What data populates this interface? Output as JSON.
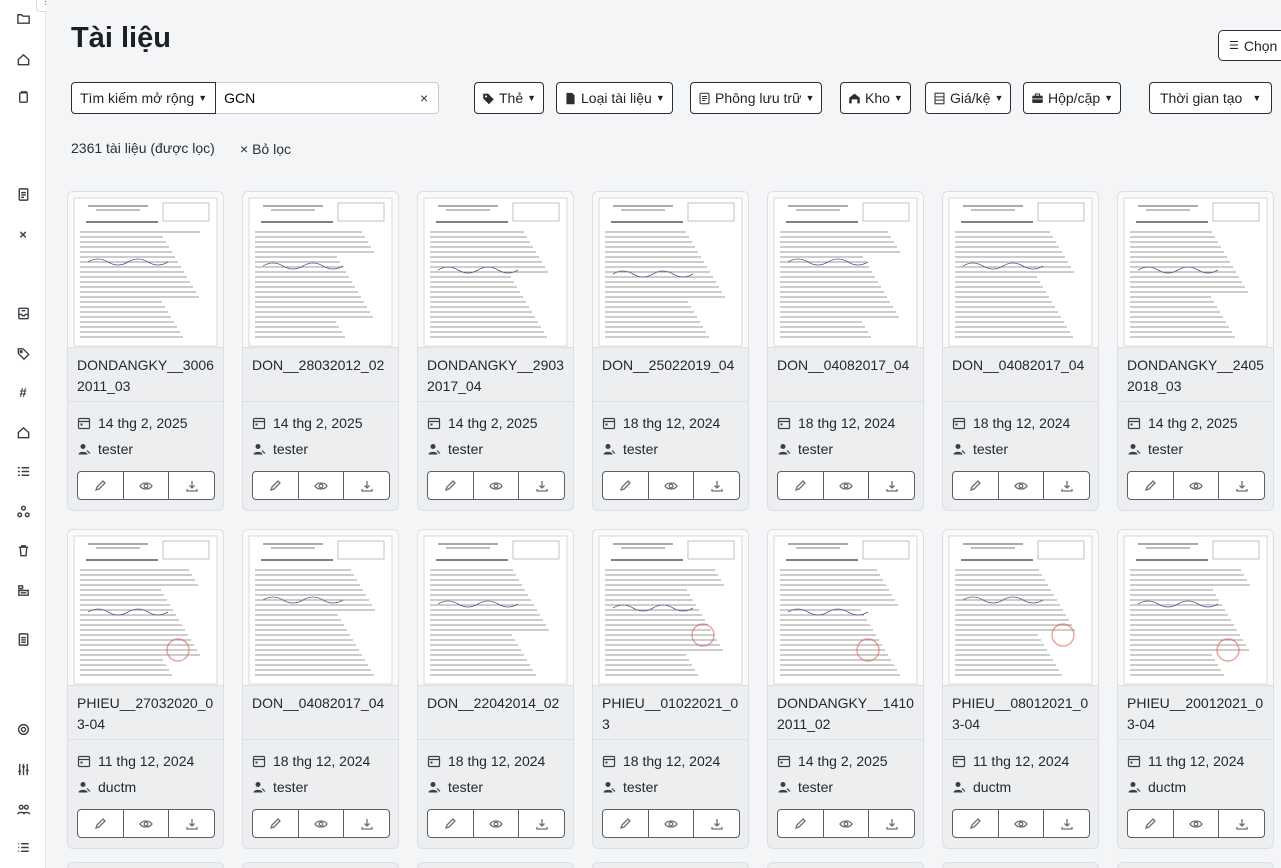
{
  "page": {
    "title": "Tài liệu",
    "choose_label": "Chọn"
  },
  "toolbar": {
    "search_mode_label": "Tìm kiếm mở rộng",
    "search_value": "GCN",
    "search_clear": "×",
    "filters": {
      "tag": "Thẻ",
      "doc_type": "Loại tài liệu",
      "archive": "Phông lưu trữ",
      "storage": "Kho",
      "shelf": "Giá/kệ",
      "box": "Hộp/cặp",
      "created": "Thời gian tạo"
    }
  },
  "results": {
    "count_text": "2361 tài liệu (được lọc)",
    "clear_filters": "× Bỏ lọc"
  },
  "documents": [
    {
      "name": "DONDANGKY__30062011_03",
      "date": "14 thg 2, 2025",
      "user": "tester"
    },
    {
      "name": "DON__28032012_02",
      "date": "14 thg 2, 2025",
      "user": "tester"
    },
    {
      "name": "DONDANGKY__29032017_04",
      "date": "14 thg 2, 2025",
      "user": "tester"
    },
    {
      "name": "DON__25022019_04",
      "date": "18 thg 12, 2024",
      "user": "tester"
    },
    {
      "name": "DON__04082017_04",
      "date": "18 thg 12, 2024",
      "user": "tester"
    },
    {
      "name": "DON__04082017_04",
      "date": "18 thg 12, 2024",
      "user": "tester"
    },
    {
      "name": "DONDANGKY__24052018_03",
      "date": "14 thg 2, 2025",
      "user": "tester"
    },
    {
      "name": "PHIEU__27032020_03-04",
      "date": "11 thg 12, 2024",
      "user": "ductm"
    },
    {
      "name": "DON__04082017_04",
      "date": "18 thg 12, 2024",
      "user": "tester"
    },
    {
      "name": "DON__22042014_02",
      "date": "18 thg 12, 2024",
      "user": "tester"
    },
    {
      "name": "PHIEU__01022021_03",
      "date": "18 thg 12, 2024",
      "user": "tester"
    },
    {
      "name": "DONDANGKY__14102011_02",
      "date": "14 thg 2, 2025",
      "user": "tester"
    },
    {
      "name": "PHIEU__08012021_03-04",
      "date": "11 thg 12, 2024",
      "user": "ductm"
    },
    {
      "name": "PHIEU__20012021_03-04",
      "date": "11 thg 12, 2024",
      "user": "ductm"
    }
  ],
  "sidebar_icons": [
    "folder-icon",
    "home-icon",
    "copy-icon",
    "document-icon",
    "close-icon",
    "inbox-icon",
    "tag-icon",
    "hash-icon",
    "home-icon",
    "list-check-icon",
    "network-icon",
    "trash-icon",
    "archive-icon",
    "file-list-icon",
    "settings-icon",
    "sliders-icon",
    "users-icon",
    "list-icon"
  ],
  "sidebar_text": {
    "hash": "#",
    "close": "×"
  },
  "colors": {
    "accent_dark": "#2b2f33",
    "card_bg": "#eceef0",
    "stamp_red": "#d9534f"
  }
}
